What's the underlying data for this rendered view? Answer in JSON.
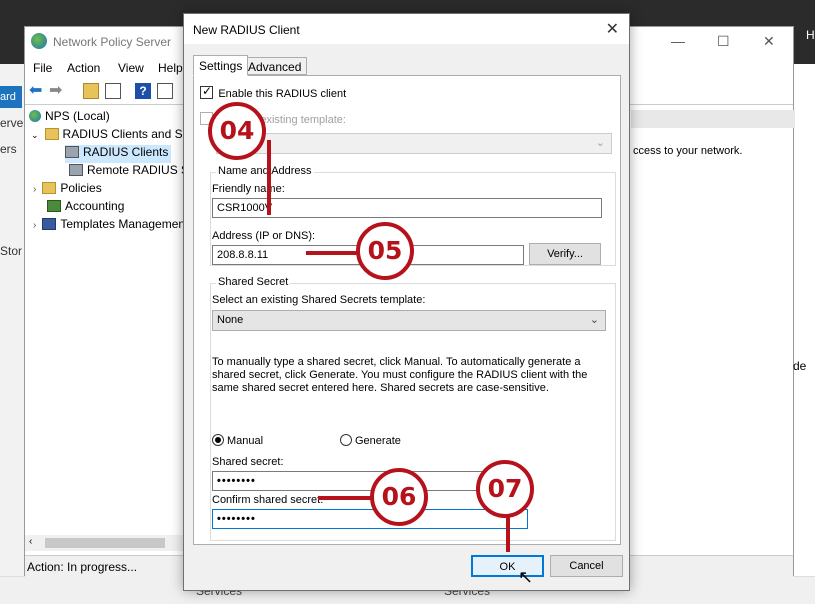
{
  "background": {
    "topright_text": "H",
    "left_tab": "ard",
    "left_texts": [
      "erver",
      "ers",
      "Stor"
    ],
    "services_labels": [
      "Services",
      "Services"
    ]
  },
  "nps": {
    "title": "Network Policy Server",
    "menu": [
      "File",
      "Action",
      "View",
      "Help"
    ],
    "tree": [
      {
        "label": "NPS (Local)"
      },
      {
        "label": "RADIUS Clients and Servers"
      },
      {
        "label": "RADIUS Clients"
      },
      {
        "label": "Remote RADIUS Server Groups"
      },
      {
        "label": "Policies"
      },
      {
        "label": "Accounting"
      },
      {
        "label": "Templates Management"
      }
    ],
    "status": "Action:  In progress...",
    "right_text": "ccess to your network.",
    "right_de": "de"
  },
  "dialog": {
    "title": "New RADIUS Client",
    "close_glyph": "✕",
    "tabs": [
      "Settings",
      "Advanced"
    ],
    "enable_checkbox": {
      "label": "Enable this RADIUS client",
      "checked": true
    },
    "template_checkbox": {
      "label": "Select an existing template:",
      "visible_label": "existing template:",
      "checked": false
    },
    "name_address_group": "Name and Address",
    "friendly_name_label": "Friendly name:",
    "friendly_name_value": "CSR1000V",
    "address_label": "Address (IP or DNS):",
    "address_value": "208.8.8.11",
    "verify_button": "Verify...",
    "shared_secret_group": "Shared Secret",
    "secret_template_label": "Select an existing Shared Secrets template:",
    "secret_template_value": "None",
    "instructions": "To manually type a shared secret, click Manual. To automatically generate a shared secret, click Generate. You must configure the RADIUS client with the same shared secret entered here. Shared secrets are case-sensitive.",
    "radio_manual": "Manual",
    "radio_generate": "Generate",
    "shared_secret_label": "Shared secret:",
    "shared_secret_value": "••••••••",
    "confirm_secret_label": "Confirm shared secret:",
    "confirm_secret_value": "••••••••",
    "ok_button": "OK",
    "cancel_button": "Cancel"
  },
  "callouts": [
    "04",
    "05",
    "06",
    "07"
  ],
  "colors": {
    "callout": "#b5121b",
    "selection": "#cce8ff",
    "focus_border": "#0078d7"
  }
}
